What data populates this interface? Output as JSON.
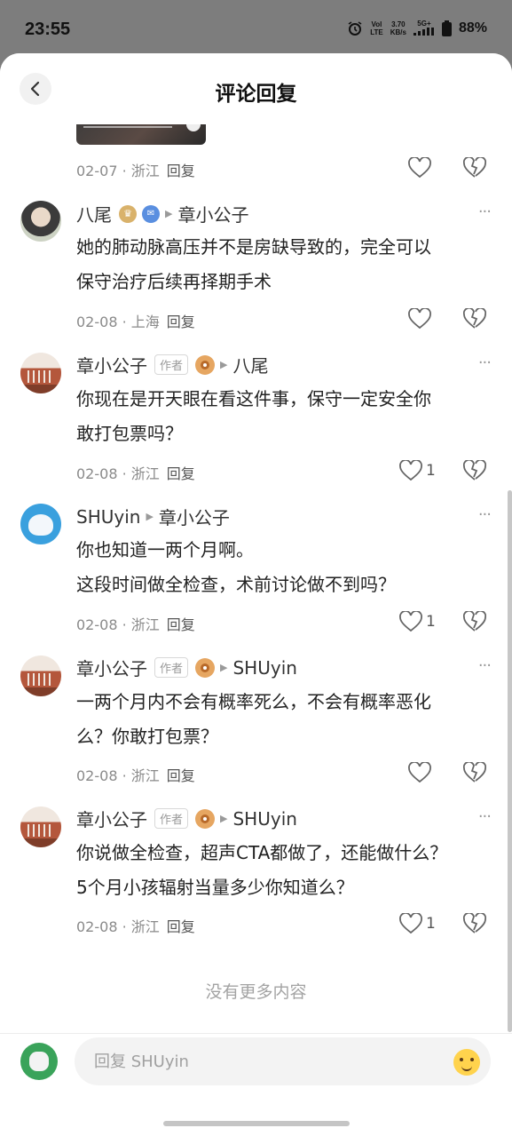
{
  "status_bar": {
    "time": "23:55",
    "network_top": "Vol",
    "network_bottom": "LTE",
    "speed_top": "3.70",
    "speed_bottom": "KB/s",
    "signal_label": "5G+",
    "battery": "88%"
  },
  "header": {
    "title": "评论回复",
    "back_icon": "chevron-left-icon"
  },
  "top_meta": {
    "date_location": "02-07 · 浙江",
    "reply_label": "回复"
  },
  "comments": [
    {
      "author": "八尾",
      "reply_to": "章小公子",
      "text_line1": "她的肺动脉高压并不是房缺导致的，完全可以",
      "text_line2": "保守治疗后续再择期手术",
      "date_location": "02-08 · 上海",
      "reply_label": "回复",
      "likes": ""
    },
    {
      "author": "章小公子",
      "author_badge": "作者",
      "reply_to": "八尾",
      "text_line1": "你现在是开天眼在看这件事，保守一定安全你",
      "text_line2": "敢打包票吗？",
      "date_location": "02-08 · 浙江",
      "reply_label": "回复",
      "likes": "1"
    },
    {
      "author": "SHUyin",
      "reply_to": "章小公子",
      "text_line1": "你也知道一两个月啊。",
      "text_line2": "这段时间做全检查，术前讨论做不到吗？",
      "date_location": "02-08 · 浙江",
      "reply_label": "回复",
      "likes": "1"
    },
    {
      "author": "章小公子",
      "author_badge": "作者",
      "reply_to": "SHUyin",
      "text_line1": "一两个月内不会有概率死么，不会有概率恶化",
      "text_line2": "么？你敢打包票？",
      "date_location": "02-08 · 浙江",
      "reply_label": "回复",
      "likes": ""
    },
    {
      "author": "章小公子",
      "author_badge": "作者",
      "reply_to": "SHUyin",
      "text_line1": "你说做全检查，超声CTA都做了，还能做什么？",
      "text_line2": "5个月小孩辐射当量多少你知道么？",
      "date_location": "02-08 · 浙江",
      "reply_label": "回复",
      "likes": "1"
    }
  ],
  "more_label": "···",
  "no_more": "没有更多内容",
  "reply_box": {
    "placeholder": "回复 SHUyin"
  },
  "colors": {
    "sheet_bg": "#ffffff",
    "backdrop": "#7d7d7d",
    "meta_gray": "#8a8a8a"
  }
}
